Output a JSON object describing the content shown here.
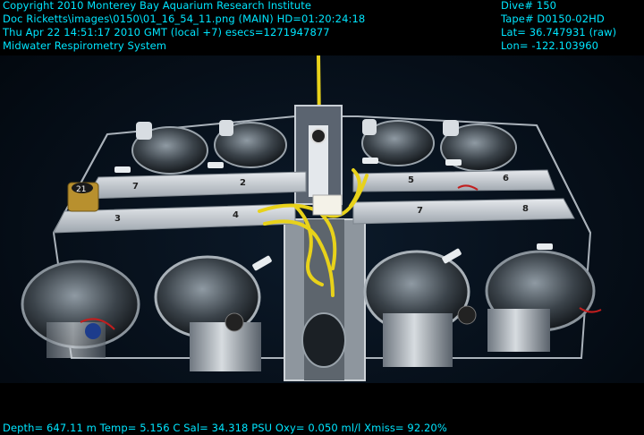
{
  "overlay": {
    "top_left": [
      "Copyright 2010 Monterey Bay Aquarium Research Institute",
      "Doc Ricketts\\images\\0150\\01_16_54_11.png (MAIN)  HD=01:20:24:18",
      "Thu Apr 22 14:51:17 2010 GMT (local +7)  esecs=1271947877",
      "Midwater Respirometry System"
    ],
    "top_right": [
      "Dive# 150",
      "Tape# D0150-02HD",
      "Lat= 36.747931 (raw)",
      "Lon= -122.103960"
    ],
    "bottom": "Depth= 647.11 m  Temp= 5.156 C  Sal= 34.318 PSU  Oxy= 0.050 ml/l  Xmiss= 92.20%"
  },
  "chamber_labels": [
    "7",
    "2",
    "5",
    "6",
    "3",
    "4",
    "7",
    "8"
  ],
  "tag_label": "21",
  "colors": {
    "overlay_text": "#00e6ff",
    "water": "#05101c",
    "rope": "#e8d21a",
    "frame_metal": "#c9cfd6"
  }
}
